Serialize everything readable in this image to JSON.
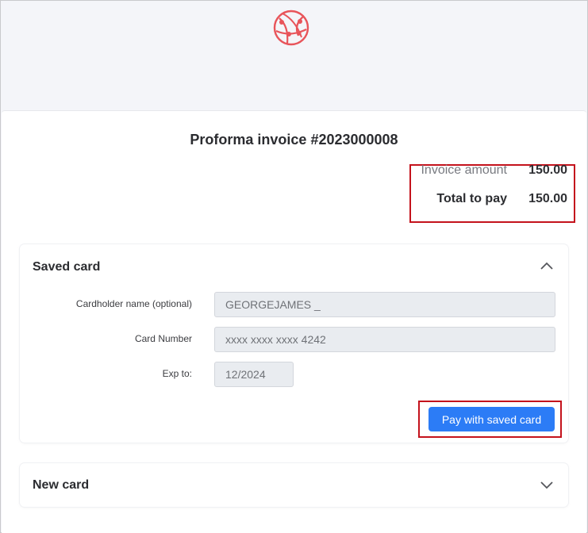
{
  "invoice": {
    "title": "Proforma invoice #2023000008",
    "amount_label": "Invoice amount",
    "amount_value": "150.00",
    "total_label": "Total to pay",
    "total_value": "150.00"
  },
  "saved_card": {
    "title": "Saved card",
    "expanded": true,
    "fields": {
      "name_label": "Cardholder name (optional)",
      "name_value": "GEORGEJAMES _",
      "number_label": "Card Number",
      "number_value": "xxxx xxxx xxxx 4242",
      "exp_label": "Exp to:",
      "exp_value": "12/2024"
    },
    "pay_button_label": "Pay with saved card"
  },
  "new_card": {
    "title": "New card",
    "expanded": false
  },
  "icons": {
    "logo": "network-globe-logo",
    "collapse": "chevron-up-icon",
    "expand": "chevron-down-icon"
  },
  "colors": {
    "accent": "#2c7cf6",
    "logo": "#e8545a",
    "highlight": "#c4121c"
  }
}
